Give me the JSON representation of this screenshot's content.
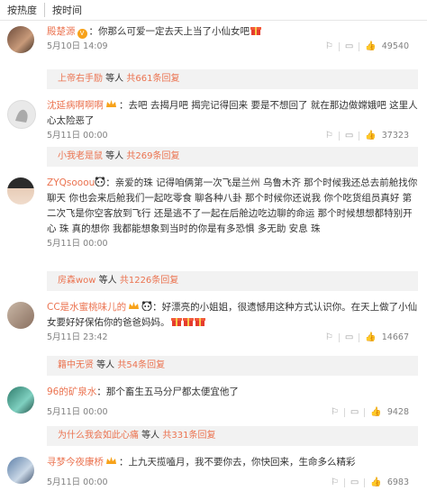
{
  "tabs": [
    {
      "label": "按热度"
    },
    {
      "label": "按时间"
    }
  ],
  "comments": [
    {
      "user": "殿楚源",
      "text": "：你那么可爱一定去天上当了小仙女吧",
      "time": "5月10日 14:09",
      "likes": "49540",
      "reply": {
        "name": "上帝右手励",
        "mid": " 等人 ",
        "count": "共661条回复"
      }
    },
    {
      "user": "沈延病啊啊啊",
      "text": "：去吧 去揭月吧 揭完记得回来 要是不想回了 就在那边做嫦娥吧 这里人心太险恶了",
      "time": "5月11日 00:00",
      "likes": "37323",
      "reply": {
        "name": "小我老是鼠",
        "mid": " 等人 ",
        "count": "共269条回复"
      }
    },
    {
      "user": "ZYQsooou",
      "text": "：亲爱的珠 记得咱俩第一次飞是兰州 乌鲁木齐 那个时候我还总去前舱找你聊天 你也会来后舱我们一起吃零食 聊各种八卦 那个时候你还说我 你个吃货组员真好 第二次飞是你空客放到飞行 还是逃不了一起在后舱边吃边聊的命运 那个时候想想都特别开心 珠 真的想你 我都能想象到当时的你是有多恐惧 多无助 安息 珠",
      "time": "5月11日 00:00",
      "likes": "",
      "reply": {
        "name": "房森wow",
        "mid": " 等人 ",
        "count": "共1226条回复"
      }
    },
    {
      "user": "CC是水蜜桃味儿的",
      "text": "：好漂亮的小姐姐，很遗憾用这种方式认识你。在天上做了小仙女要好好保佑你的爸爸妈妈。",
      "time": "5月11日 23:42",
      "likes": "14667",
      "reply": {
        "name": "籍中无贤",
        "mid": " 等人 ",
        "count": "共54条回复"
      }
    },
    {
      "user": "96的矿泉水",
      "text": "：那个畜生五马分尸都太便宜他了",
      "time": "5月11日 00:00",
      "likes": "9428",
      "reply": {
        "name": "为什么我会如此心痛",
        "mid": " 等人 ",
        "count": "共331条回复"
      }
    },
    {
      "user": "寻梦今夜康桥",
      "text": "：上九天揽嗑月，我不要你去，你快回来，生命多么精彩",
      "time": "5月11日 00:00",
      "likes": "6983",
      "reply": null
    }
  ],
  "colors": {
    "accent": "#eb7350",
    "reply_bg": "#f2f2f2",
    "meta": "#808080"
  }
}
